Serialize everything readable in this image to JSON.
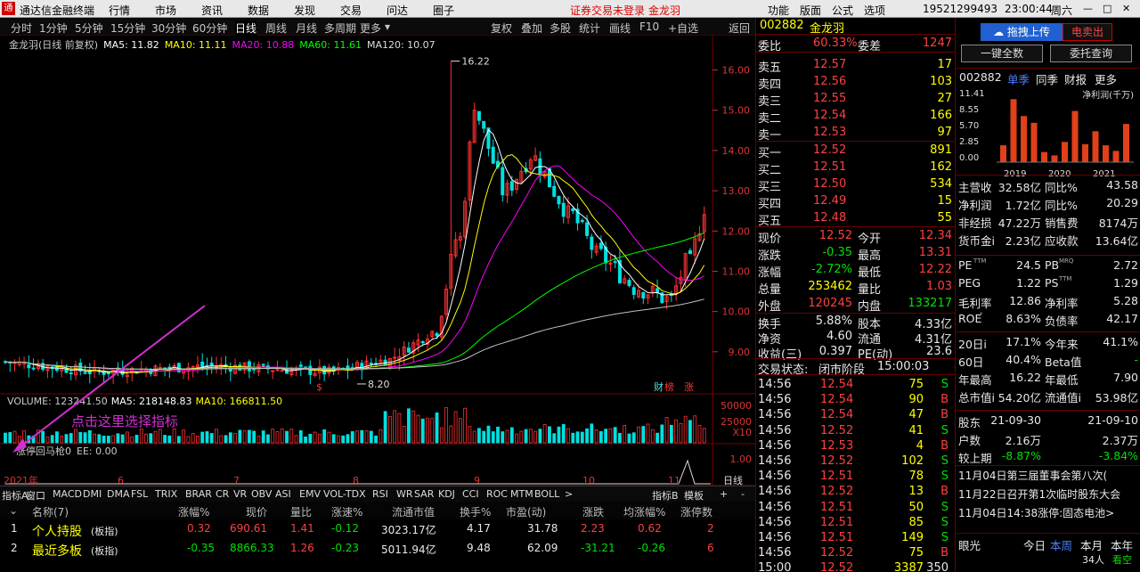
{
  "menu": {
    "logo": "通",
    "app": "通达信金融终端",
    "items": [
      "行情",
      "市场",
      "资讯",
      "数据",
      "发现",
      "交易",
      "问达",
      "圈子"
    ],
    "status_red": "证券交易未登录",
    "status_stock": "金龙羽",
    "right": [
      "功能",
      "版面",
      "公式",
      "选项"
    ],
    "phone": "19521299493",
    "time": "23:00:44",
    "weekday": "周六"
  },
  "periods": [
    "分时",
    "1分钟",
    "5分钟",
    "15分钟",
    "30分钟",
    "60分钟",
    "日线",
    "周线",
    "月线",
    "多周期",
    "更多"
  ],
  "toolbar": [
    "复权",
    "叠加",
    "多股",
    "统计",
    "画线",
    "F10",
    "+自选",
    "返回"
  ],
  "ma_line": {
    "title": "金龙羽(日线 前复权)",
    "ma5": "MA5: 11.82",
    "ma10": "MA10: 11.11",
    "ma20": "MA20: 10.88",
    "ma60": "MA60: 11.61",
    "ma120": "MA120: 10.07"
  },
  "annot": {
    "high": "16.22",
    "low": "8.20",
    "hint": "点击这里选择指标",
    "badge1": "财",
    "badge2": "榜",
    "badge3": "涨",
    "dollar": "$"
  },
  "vol_line": {
    "vol": "VOLUME: 123241.50",
    "ma5": "MA5: 218148.83",
    "ma10": "MA10: 166811.50"
  },
  "ind_line": {
    "name": "涨停回马枪0",
    "ee": "EE: 0.00"
  },
  "time_axis": {
    "year": "2021年",
    "months": [
      "6",
      "7",
      "8",
      "9",
      "10",
      "11"
    ],
    "tag": "日线"
  },
  "colors": {
    "up": "#ff3030",
    "down": "#00e0e0",
    "ma5": "#ffffff",
    "ma10": "#ffff00",
    "ma20": "#ff00ff",
    "ma60": "#00ff00",
    "ma120": "#c0c0c0"
  },
  "chart_data": {
    "type": "candlestick",
    "price_axis": [
      "16.00",
      "15.00",
      "14.00",
      "13.00",
      "12.00",
      "11.00",
      "10.00",
      "9.00"
    ],
    "ylim": [
      8.0,
      16.3
    ],
    "vol_axis": [
      "50000",
      "25000",
      "X10"
    ],
    "ind_axis": [
      "1.00"
    ],
    "price": {
      "low": 8.2,
      "high": 16.22
    },
    "vol_ylim": [
      0,
      50000
    ],
    "ind_ylim": [
      0,
      1.2
    ]
  },
  "tabs": [
    "指标A",
    "窗口",
    "MACD",
    "DMI",
    "DMA",
    "FSL",
    "TRIX",
    "BRAR",
    "CR",
    "VR",
    "OBV",
    "ASI",
    "EMV",
    "VOL-TDX",
    "RSI",
    "WR",
    "SAR",
    "KDJ",
    "CCI",
    "ROC",
    "MTM",
    "BOLL",
    ">",
    "指标B",
    "模板",
    "+",
    "-"
  ],
  "list": {
    "headers": [
      "名称(7)",
      "涨幅%",
      "现价",
      "量比",
      "涨速%",
      "流通市值",
      "换手%",
      "市盈(动)",
      "涨跌",
      "均涨幅%",
      "涨停数"
    ],
    "rows": [
      {
        "no": "1",
        "name": "个人持股",
        "tag": "(板指)",
        "chg": "0.32",
        "price": "690.61",
        "vr": "1.41",
        "spd": "-0.12",
        "cap": "3023.17亿",
        "turn": "4.17",
        "pe": "31.78",
        "diff": "2.23",
        "avg": "0.62",
        "lim": "2"
      },
      {
        "no": "2",
        "name": "最近多板",
        "tag": "(板指)",
        "chg": "-0.35",
        "price": "8866.33",
        "vr": "1.26",
        "spd": "-0.23",
        "cap": "5011.94亿",
        "turn": "9.48",
        "pe": "62.09",
        "diff": "-31.21",
        "avg": "-0.26",
        "lim": "6"
      }
    ]
  },
  "quote": {
    "code": "002882",
    "name": "金龙羽",
    "weibi_l": "委比",
    "weibi": "60.33%",
    "weicha_l": "委差",
    "weicha": "1247",
    "sells": [
      {
        "l": "卖五",
        "p": "12.57",
        "v": "17"
      },
      {
        "l": "卖四",
        "p": "12.56",
        "v": "103"
      },
      {
        "l": "卖三",
        "p": "12.55",
        "v": "27"
      },
      {
        "l": "卖二",
        "p": "12.54",
        "v": "166"
      },
      {
        "l": "卖一",
        "p": "12.53",
        "v": "97"
      }
    ],
    "buys": [
      {
        "l": "买一",
        "p": "12.52",
        "v": "891"
      },
      {
        "l": "买二",
        "p": "12.51",
        "v": "162"
      },
      {
        "l": "买三",
        "p": "12.50",
        "v": "534"
      },
      {
        "l": "买四",
        "p": "12.49",
        "v": "15"
      },
      {
        "l": "买五",
        "p": "12.48",
        "v": "55"
      }
    ],
    "stats": [
      {
        "a": "现价",
        "av": "12.52",
        "b": "今开",
        "bv": "12.34",
        "ac": "red",
        "bc": "red"
      },
      {
        "a": "涨跌",
        "av": "-0.35",
        "b": "最高",
        "bv": "13.31",
        "ac": "grn",
        "bc": "red"
      },
      {
        "a": "涨幅",
        "av": "-2.72%",
        "b": "最低",
        "bv": "12.22",
        "ac": "grn",
        "bc": "red"
      },
      {
        "a": "总量",
        "av": "253462",
        "b": "量比",
        "bv": "1.03",
        "ac": "yel",
        "bc": "red"
      },
      {
        "a": "外盘",
        "av": "120245",
        "b": "内盘",
        "bv": "133217",
        "ac": "red",
        "bc": "grn"
      }
    ],
    "stats2": [
      {
        "a": "换手",
        "av": "5.88%",
        "b": "股本",
        "bv": "4.33亿"
      },
      {
        "a": "净资",
        "av": "4.60",
        "b": "流通",
        "bv": "4.31亿"
      },
      {
        "a": "收益(三)",
        "av": "0.397",
        "b": "PE(动)",
        "bv": "23.6"
      }
    ],
    "state_l": "交易状态:",
    "state": "闭市阶段",
    "state_t": "15:00:03",
    "ticks": [
      {
        "t": "14:56",
        "p": "12.54",
        "v": "75",
        "d": "S"
      },
      {
        "t": "14:56",
        "p": "12.54",
        "v": "90",
        "d": "B"
      },
      {
        "t": "14:56",
        "p": "12.54",
        "v": "47",
        "d": "B"
      },
      {
        "t": "14:56",
        "p": "12.52",
        "v": "41",
        "d": "S"
      },
      {
        "t": "14:56",
        "p": "12.53",
        "v": "4",
        "d": "B"
      },
      {
        "t": "14:56",
        "p": "12.52",
        "v": "102",
        "d": "S"
      },
      {
        "t": "14:56",
        "p": "12.51",
        "v": "78",
        "d": "S"
      },
      {
        "t": "14:56",
        "p": "12.52",
        "v": "13",
        "d": "B"
      },
      {
        "t": "14:56",
        "p": "12.51",
        "v": "50",
        "d": "S"
      },
      {
        "t": "14:56",
        "p": "12.51",
        "v": "85",
        "d": "S"
      },
      {
        "t": "14:56",
        "p": "12.51",
        "v": "149",
        "d": "S"
      },
      {
        "t": "14:56",
        "p": "12.52",
        "v": "75",
        "d": "B"
      },
      {
        "t": "15:00",
        "p": "12.52",
        "v": "3387",
        "d": "350"
      }
    ]
  },
  "info": {
    "btn_upload": "拖拽上传",
    "btn_e": "电卖出",
    "btn_buy": "一键全数",
    "btn_query": "委托查询",
    "code": "002882",
    "tabs": [
      "单季",
      "同季",
      "财报",
      "更多"
    ],
    "fin_max": "11.41",
    "fin_ticks": [
      "8.55",
      "5.70",
      "2.85",
      "0.00"
    ],
    "fin_label": "净利润(千万)",
    "years": [
      "2019",
      "2020",
      "2021"
    ],
    "fin_bars": [
      3.0,
      11.2,
      8.2,
      7.0,
      1.8,
      1.2,
      3.6,
      9.1,
      3.2,
      5.5,
      3.0,
      2.0,
      6.8
    ],
    "rows1": [
      {
        "a": "主营收",
        "av": "32.58亿",
        "b": "同比%",
        "bv": "43.58"
      },
      {
        "a": "净利润",
        "av": "1.72亿",
        "b": "同比%",
        "bv": "20.29"
      },
      {
        "a": "非经损",
        "av": "47.22万",
        "b": "销售费",
        "bv": "8174万"
      },
      {
        "a": "货币金i",
        "av": "2.23亿",
        "b": "应收款",
        "bv": "13.64亿"
      }
    ],
    "rows2": [
      {
        "a": "PE",
        "sup": "TTM",
        "av": "24.5",
        "b": "PB",
        "sup2": "MRQ",
        "bv": "2.72"
      },
      {
        "a": "PEG",
        "av": "1.22",
        "b": "PS",
        "sup2": "TTM",
        "bv": "1.29"
      },
      {
        "a": "毛利率",
        "av": "12.86",
        "b": "净利率",
        "bv": "5.28"
      },
      {
        "a": "ROE",
        "sup": "*",
        "av": "8.63%",
        "b": "负债率",
        "bv": "42.17"
      }
    ],
    "rows3": [
      {
        "a": "20日i",
        "av": "17.1%",
        "b": "今年来",
        "bv": "41.1%"
      },
      {
        "a": "60日",
        "av": "40.4%",
        "b": "Beta值",
        "bv": "-"
      },
      {
        "a": "年最高",
        "av": "16.22",
        "b": "年最低",
        "bv": "7.90"
      },
      {
        "a": "总市值i",
        "av": "54.20亿",
        "b": "流通值i",
        "bv": "53.98亿"
      }
    ],
    "rows4": [
      {
        "a": "股东",
        "av": "21-09-30",
        "bv": "21-09-10"
      },
      {
        "a": "户数",
        "av": "2.16万",
        "bv": "2.37万"
      },
      {
        "a": "较上期",
        "av": "-8.87%",
        "bv": "-3.84%"
      }
    ],
    "news": [
      "11月04日第三届董事会第八次(",
      "11月22日召开第1次临时股东大会",
      "11月04日14:38涨停:固态电池>"
    ],
    "bottom": {
      "a": "眼光",
      "b": "今日",
      "c": "本周",
      "d": "本月",
      "e": "本年",
      "f": "34人",
      "g": "看空"
    }
  }
}
